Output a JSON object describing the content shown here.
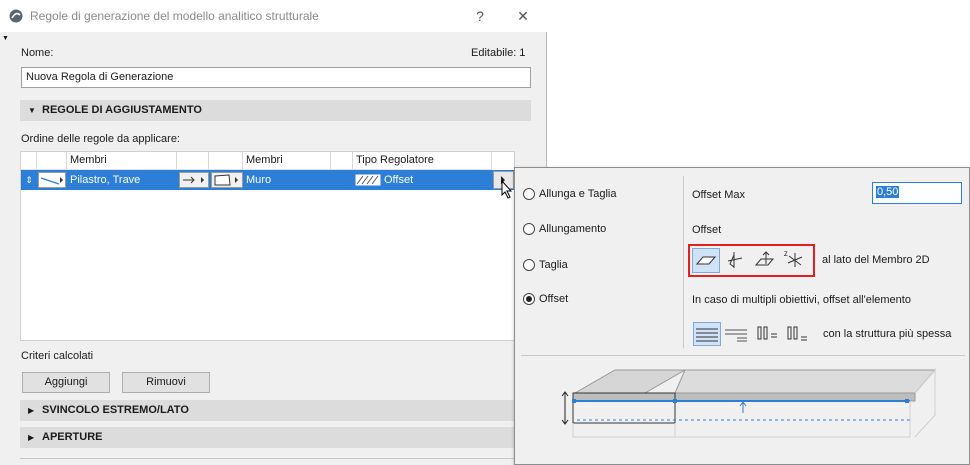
{
  "dialog": {
    "title": "Regole di generazione del modello analitico strutturale",
    "help": "?",
    "close": "✕",
    "name_label": "Nome:",
    "editable_label": "Editabile: 1",
    "name_value": "Nuova Regola di Generazione"
  },
  "sections": {
    "adjust": "REGOLE DI AGGIUSTAMENTO",
    "free_end": "SVINCOLO ESTREMO/LATO",
    "openings": "APERTURE"
  },
  "rules": {
    "order_label": "Ordine delle regole da applicare:",
    "headers": {
      "members1": "Membri",
      "members2": "Membri",
      "type": "Tipo Regolatore"
    },
    "row": {
      "members1": "Pilastro, Trave",
      "members2": "Muro",
      "type": "Offset"
    }
  },
  "criteria": {
    "label": "Criteri calcolati",
    "add": "Aggiungi",
    "remove": "Rimuovi"
  },
  "popup": {
    "options": [
      "Allunga e Taglia",
      "Allungamento",
      "Taglia",
      "Offset"
    ],
    "selected": "Offset",
    "offset_max_label": "Offset Max",
    "offset_max_value": "0,50",
    "offset_label": "Offset",
    "side_text": "al lato del Membro 2D",
    "multi_text": "In caso di multipli obiettivi, offset all'elemento",
    "thick_text": "con la struttura più spessa",
    "highlight_color": "#e02020",
    "accent": "#2d7ed6"
  }
}
